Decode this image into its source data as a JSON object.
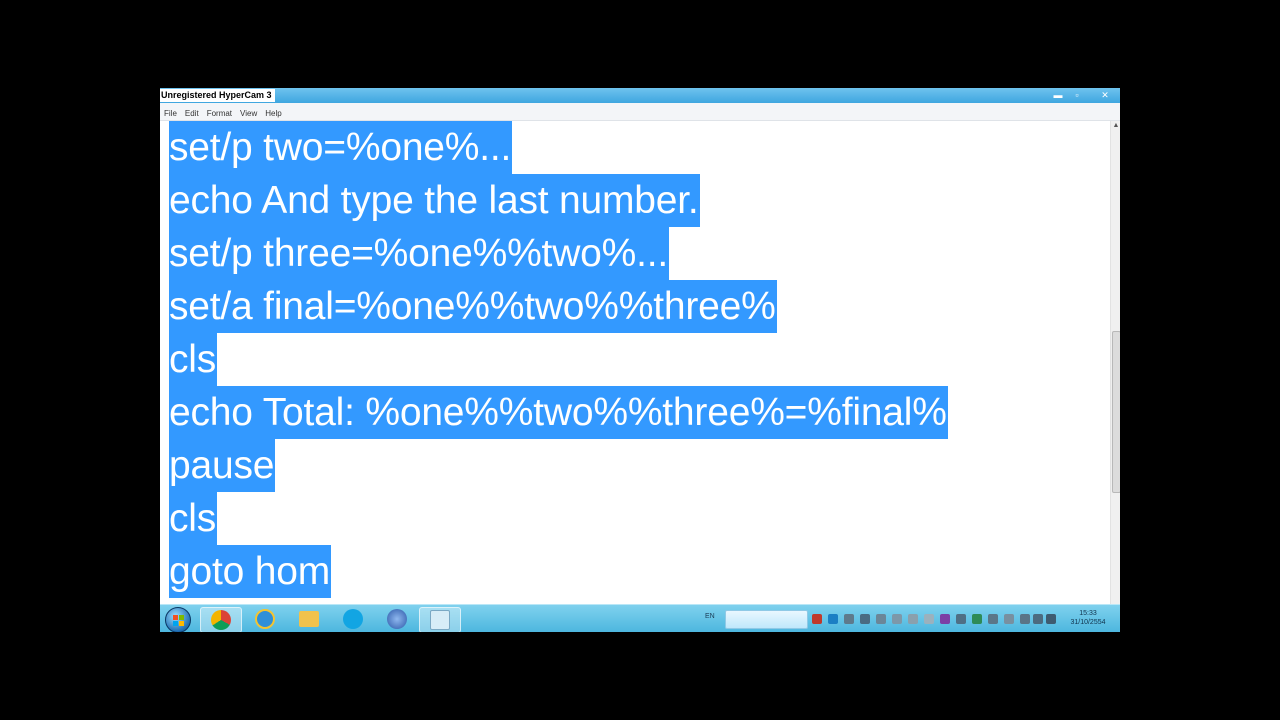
{
  "recorder": {
    "watermark": "Unregistered HyperCam 3"
  },
  "window": {
    "controls": {
      "minimize": "▬",
      "maximize": "▫",
      "close": "✕"
    }
  },
  "menu": [
    "File",
    "Edit",
    "Format",
    "View",
    "Help"
  ],
  "editor": {
    "selection_color": "#3399ff",
    "lines": [
      "set/p two=%one%...",
      "echo And type the last number.",
      "set/p three=%one%%two%...",
      "set/a final=%one%%two%%three%",
      "cls",
      "echo Total: %one%%two%%three%=%final%",
      "pause",
      "cls",
      "goto hom"
    ]
  },
  "scrollbar": {
    "up_arrow": "▲"
  },
  "taskbar": {
    "apps": [
      {
        "name": "Chrome",
        "icon": "chrome-icon",
        "color": "#e04a3a"
      },
      {
        "name": "Internet Explorer",
        "icon": "ie-icon",
        "color": "#2f8fd8"
      },
      {
        "name": "Windows Explorer",
        "icon": "folder-icon",
        "color": "#f1c24c"
      },
      {
        "name": "Skype",
        "icon": "skype-icon",
        "color": "#12a5e3"
      },
      {
        "name": "iTunes",
        "icon": "itunes-icon",
        "color": "#3b6fc2"
      },
      {
        "name": "Notepad",
        "icon": "notepad-icon",
        "color": "#b8d8ea"
      }
    ],
    "language": "EN",
    "clock": {
      "time": "15:33",
      "date": "31/10/2554"
    }
  }
}
